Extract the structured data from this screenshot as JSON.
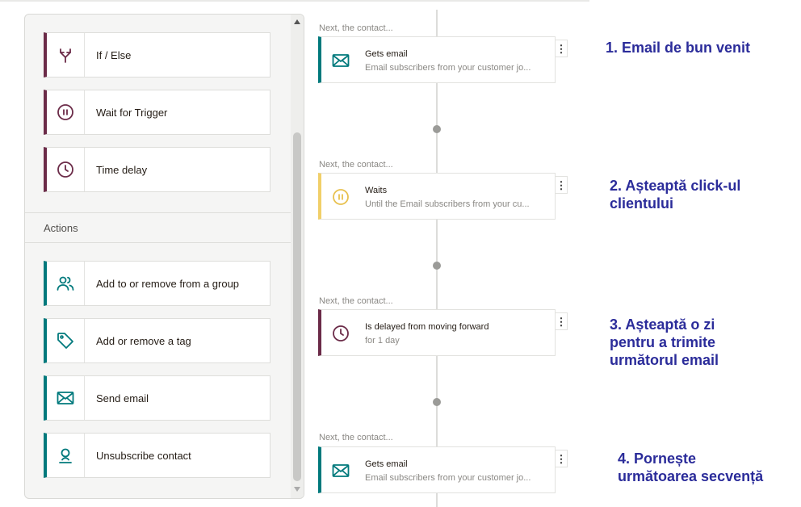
{
  "palette": {
    "triggers": [
      {
        "label": "If / Else",
        "icon": "split-arrows-icon"
      },
      {
        "label": "Wait for Trigger",
        "icon": "pause-circle-icon"
      },
      {
        "label": "Time delay",
        "icon": "clock-icon"
      }
    ],
    "actions_heading": "Actions",
    "actions": [
      {
        "label": "Add to or remove from a group",
        "icon": "group-people-icon"
      },
      {
        "label": "Add or remove a tag",
        "icon": "tag-icon"
      },
      {
        "label": "Send email",
        "icon": "envelope-icon"
      },
      {
        "label": "Unsubscribe contact",
        "icon": "person-icon"
      }
    ]
  },
  "workflow": {
    "next_label": "Next, the contact...",
    "steps": [
      {
        "title": "Gets email",
        "subtitle": "Email subscribers from your customer jo...",
        "icon": "envelope-icon",
        "kind": "email"
      },
      {
        "title": "Waits",
        "subtitle": "Until the Email subscribers from your cu...",
        "icon": "pause-circle-icon",
        "kind": "wait"
      },
      {
        "title": "Is delayed from moving forward",
        "subtitle": "for 1 day",
        "icon": "clock-icon",
        "kind": "delay"
      },
      {
        "title": "Gets email",
        "subtitle": "Email subscribers from your customer jo...",
        "icon": "envelope-icon",
        "kind": "email"
      }
    ],
    "menu_glyph": "⋮"
  },
  "annotations": [
    "1. Email de bun venit",
    "2. Așteaptă click-ul\nclientului",
    "3. Așteaptă o zi\npentru a trimite\nurmătorul email",
    "4. Pornește\nurmătoarea secvență"
  ],
  "colors": {
    "trigger_accent": "#6b2b48",
    "action_accent": "#00797c",
    "wait_accent": "#f1cf69",
    "annotation_text": "#2b2c9a"
  }
}
